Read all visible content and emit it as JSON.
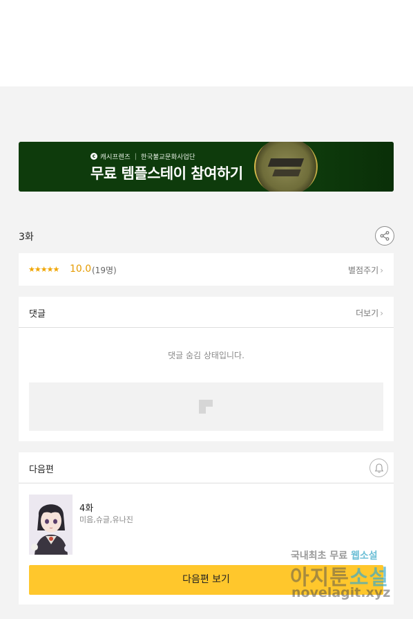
{
  "banner": {
    "sponsor_brand": "캐시프렌즈",
    "sponsor_partner": "한국불교문화사업단",
    "headline": "무료 템플스테이 참여하기"
  },
  "episode": {
    "title": "3화"
  },
  "rating": {
    "stars": "★★★★★",
    "score": "10.0",
    "count": "(19명)",
    "rate_label": "별점주기"
  },
  "comments": {
    "label": "댓글",
    "more_label": "더보기",
    "hidden_message": "댓글 숨김 상태입니다."
  },
  "next_episode": {
    "section_label": "다음편",
    "title": "4화",
    "authors": "미음,슈글,유나진",
    "button_label": "다음편 보기"
  },
  "watermark": {
    "line1_a": "국내최초 무료",
    "line1_b": "웹소설",
    "line2_a": "아지툰",
    "line2_b": "소설",
    "line3": "novelagit.xyz"
  },
  "colors": {
    "banner_bg": "#0e3b0c",
    "accent_star": "#f0a500",
    "next_button": "#ffc72c"
  },
  "icons": {
    "share": "share-icon",
    "chevron": "chevron-right-icon",
    "bell": "bell-icon",
    "ad_placeholder": "ad-placeholder-icon"
  }
}
